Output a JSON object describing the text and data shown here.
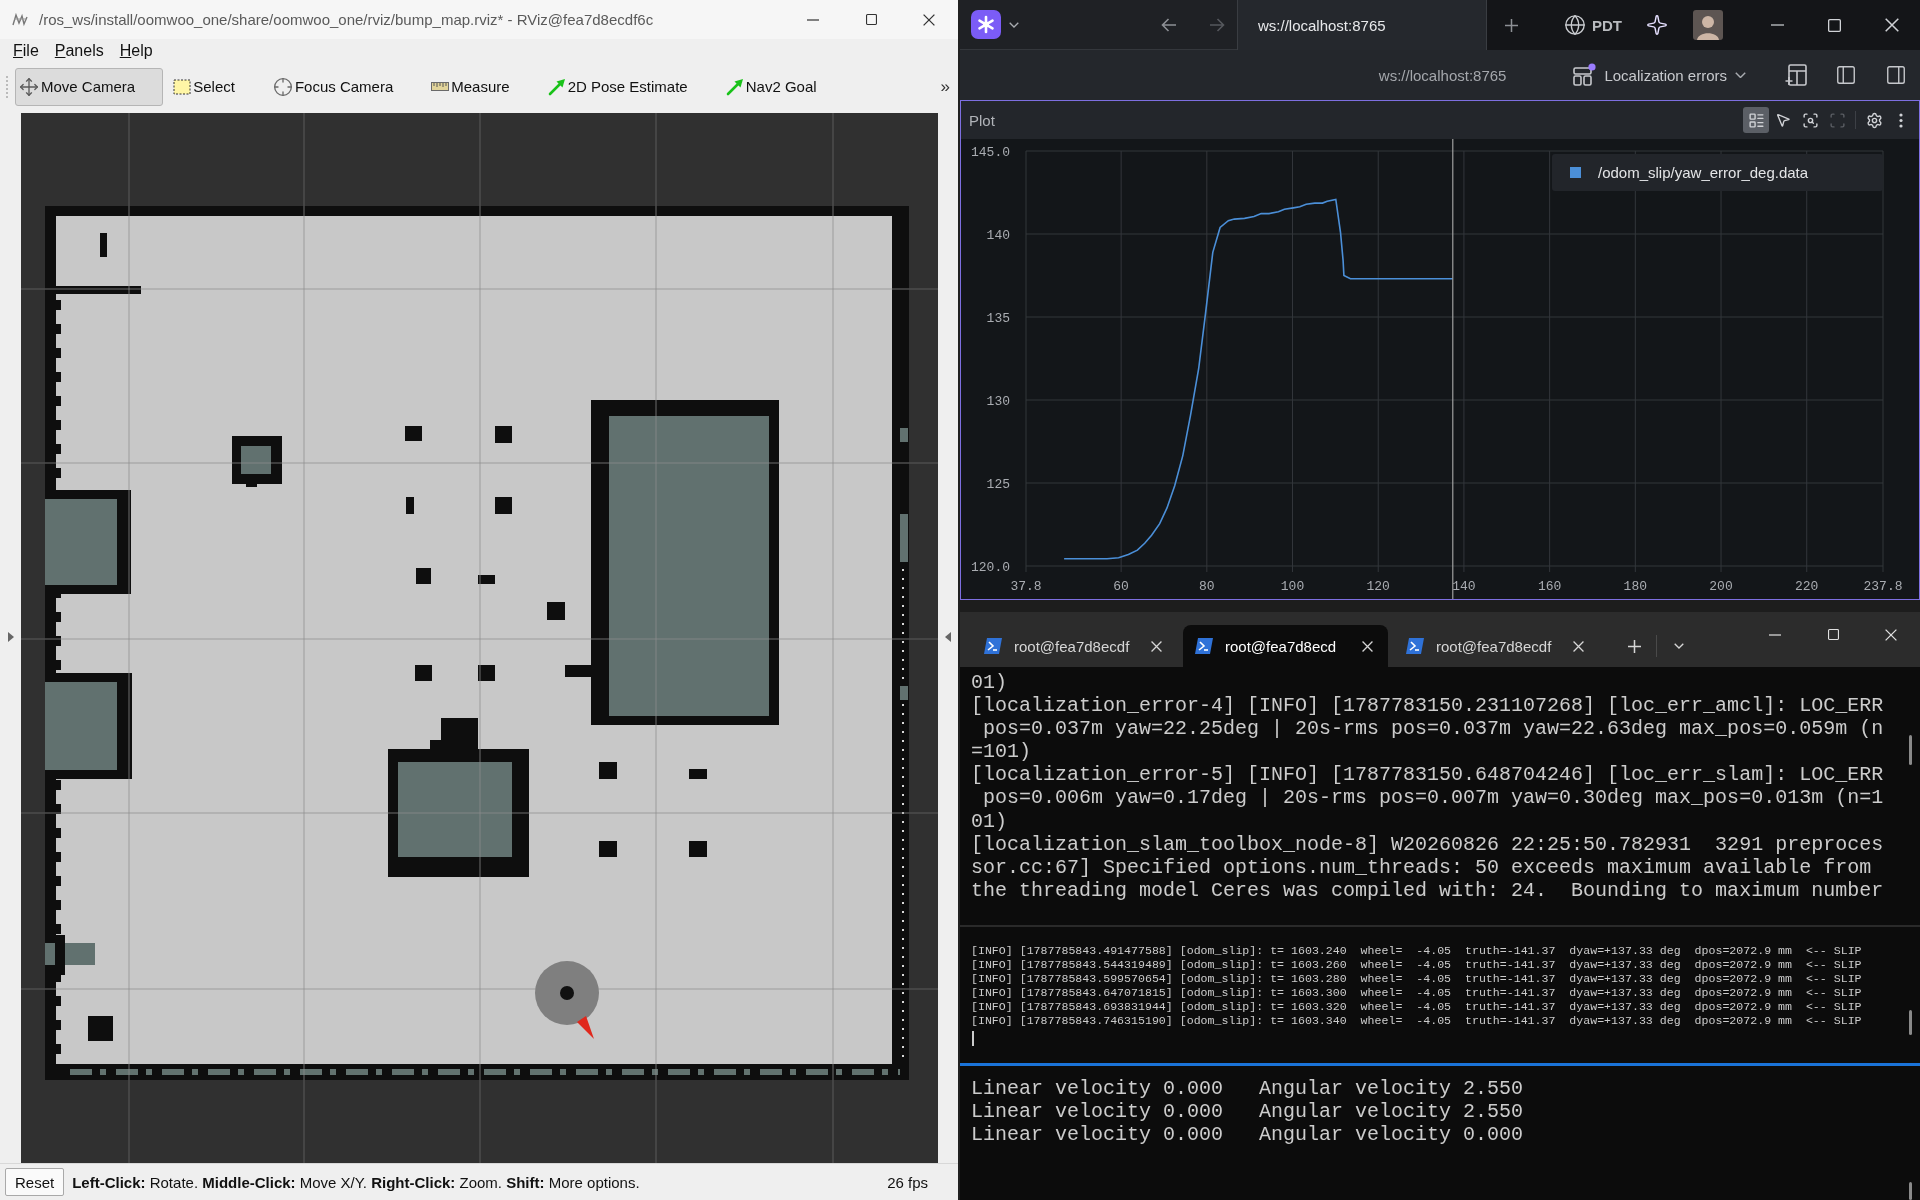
{
  "rviz": {
    "window": {
      "title": "/ros_ws/install/oomwoo_one/share/oomwoo_one/rviz/bump_map.rviz* - RViz@fea7d8ecdf6c"
    },
    "menu": [
      {
        "label": "File"
      },
      {
        "label": "Panels"
      },
      {
        "label": "Help"
      }
    ],
    "toolbar": [
      {
        "kind": "move",
        "label": "Move Camera",
        "selected": true
      },
      {
        "kind": "select",
        "label": "Select",
        "selected": false
      },
      {
        "kind": "focus",
        "label": "Focus Camera",
        "selected": false
      },
      {
        "kind": "measure",
        "label": "Measure",
        "selected": false
      },
      {
        "kind": "pose",
        "label": "2D Pose Estimate",
        "selected": false
      },
      {
        "kind": "goal",
        "label": "Nav2 Goal",
        "selected": false
      }
    ],
    "toolbar_overflow": "»",
    "status_bar": {
      "button": "Reset",
      "hint": "**Left-Click:** Rotate. **Middle-Click:** Move X/Y. **Right-Click:** Zoom. **Shift:** More options.",
      "fps": "26 fps"
    }
  },
  "foxglove": {
    "tabs": [
      {
        "label": "ws://localhost:8765",
        "selected": true
      }
    ],
    "timezone": "PDT",
    "connection": "ws://localhost:8765",
    "layout": {
      "name": "Localization errors",
      "unsaved": true
    },
    "panel": {
      "title": "Plot",
      "tools": [
        {
          "kind": "legend",
          "selected": true,
          "disabled": false
        },
        {
          "kind": "pointer",
          "selected": false,
          "disabled": false
        },
        {
          "kind": "zoom",
          "selected": false,
          "disabled": false
        },
        {
          "kind": "fit",
          "selected": false,
          "disabled": true
        },
        {
          "kind": "settings",
          "selected": false,
          "disabled": false
        },
        {
          "kind": "more",
          "selected": false,
          "disabled": false
        }
      ],
      "chart_data": {
        "type": "line",
        "x": [
          46.7,
          56.7,
          59.4,
          61.7,
          63.8,
          65.5,
          67.1,
          69.0,
          70.7,
          72.5,
          74.4,
          76.2,
          78.1,
          79.7,
          81.4,
          83.1,
          85.0,
          86.4,
          88.8,
          91.0,
          92.7,
          94.5,
          96.7,
          98.1,
          100.2,
          101.7,
          103.2,
          105.2,
          107.0,
          108.1,
          110.1,
          111.2,
          111.8,
          112.0,
          113.5,
          137.4
        ],
        "series": [
          {
            "name": "/odom_slip/yaw_error_deg.data",
            "color": "#4b8fd8",
            "values": [
              120.44,
              120.44,
              120.5,
              120.7,
              120.96,
              121.37,
              121.85,
              122.55,
              123.5,
              124.84,
              126.65,
              129.08,
              131.9,
              135.2,
              138.9,
              140.4,
              140.8,
              140.9,
              140.94,
              141.05,
              141.23,
              141.23,
              141.34,
              141.49,
              141.57,
              141.64,
              141.79,
              141.86,
              141.86,
              141.97,
              142.08,
              140.1,
              138.4,
              137.5,
              137.3,
              137.3
            ]
          }
        ],
        "xlim": [
          37.8,
          237.8
        ],
        "ylim": [
          120,
          145
        ],
        "xticks": [
          {
            "value": 37.8,
            "label": "37.8"
          },
          60,
          80,
          100,
          120,
          140,
          160,
          180,
          200,
          220,
          {
            "value": 237.8,
            "label": "237.8"
          }
        ],
        "yticks": [
          {
            "value": 120,
            "label": "120.0"
          },
          125,
          130,
          135,
          140,
          {
            "value": 145,
            "label": "145.0"
          }
        ],
        "grid": true,
        "ref_lines": [
          {
            "axis": "x",
            "value": 137.4,
            "color": "#a0a0a0"
          }
        ]
      }
    }
  },
  "terminal": {
    "tabs": [
      {
        "label": "root@fea7d8ecdf",
        "selected": false
      },
      {
        "label": "root@fea7d8ecd",
        "selected": true
      },
      {
        "label": "root@fea7d8ecdf",
        "selected": false
      }
    ],
    "panes": [
      {
        "kind": "normal",
        "focused": false,
        "cursor": false,
        "lines": [
          "01)",
          "[localization_error-4] [INFO] [1787783150.231107268] [loc_err_amcl]: LOC_ERR",
          " pos=0.037m yaw=22.25deg | 20s-rms pos=0.037m yaw=22.63deg max_pos=0.059m (n",
          "=101)",
          "[localization_error-5] [INFO] [1787783150.648704246] [loc_err_slam]: LOC_ERR",
          " pos=0.006m yaw=0.17deg | 20s-rms pos=0.007m yaw=0.30deg max_pos=0.013m (n=1",
          "01)",
          "[localization_slam_toolbox_node-8] W20260826 22:25:50.782931  3291 preproces",
          "sor.cc:67] Specified options.num_threads: 50 exceeds maximum available from",
          "the threading model Ceres was compiled with: 24.  Bounding to maximum number"
        ]
      },
      {
        "kind": "compact",
        "focused": false,
        "cursor": true,
        "lines": [
          "[INFO] [1787785843.491477588] [odom_slip]: t= 1603.240  wheel=  -4.05  truth=-141.37  dyaw=+137.33 deg  dpos=2072.9 mm  <-- SLIP",
          "[INFO] [1787785843.544319489] [odom_slip]: t= 1603.260  wheel=  -4.05  truth=-141.37  dyaw=+137.33 deg  dpos=2072.9 mm  <-- SLIP",
          "[INFO] [1787785843.599570654] [odom_slip]: t= 1603.280  wheel=  -4.05  truth=-141.37  dyaw=+137.33 deg  dpos=2072.9 mm  <-- SLIP",
          "[INFO] [1787785843.647071815] [odom_slip]: t= 1603.300  wheel=  -4.05  truth=-141.37  dyaw=+137.33 deg  dpos=2072.9 mm  <-- SLIP",
          "[INFO] [1787785843.693831944] [odom_slip]: t= 1603.320  wheel=  -4.05  truth=-141.37  dyaw=+137.33 deg  dpos=2072.9 mm  <-- SLIP",
          "[INFO] [1787785843.746315190] [odom_slip]: t= 1603.340  wheel=  -4.05  truth=-141.37  dyaw=+137.33 deg  dpos=2072.9 mm  <-- SLIP"
        ]
      },
      {
        "kind": "normal",
        "focused": true,
        "cursor": false,
        "lines": [
          "Linear velocity 0.000   Angular velocity 2.550",
          "Linear velocity 0.000   Angular velocity 2.550",
          "Linear velocity 0.000   Angular velocity 0.000"
        ]
      }
    ]
  }
}
